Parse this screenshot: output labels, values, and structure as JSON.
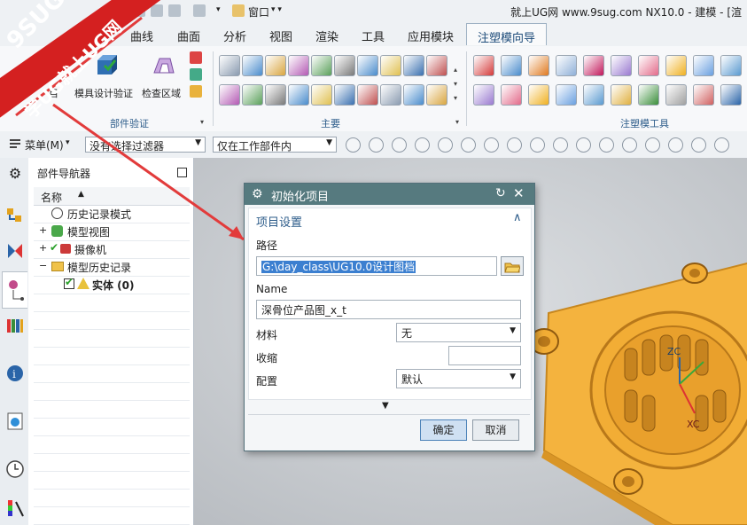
{
  "window": {
    "title": "就上UG网 www.9sug.com NX10.0 - 建模 - [渲",
    "menu_label": "窗口"
  },
  "tabs": [
    {
      "label": "曲线"
    },
    {
      "label": "曲面"
    },
    {
      "label": "分析"
    },
    {
      "label": "视图"
    },
    {
      "label": "渲染"
    },
    {
      "label": "工具"
    },
    {
      "label": "应用模块"
    },
    {
      "label": "注塑模向导"
    }
  ],
  "ribbon": {
    "group1": {
      "label": "部件验证",
      "btn_partial": "目",
      "btn_mold_verify": "模具设计验证",
      "btn_check_region": "检查区域"
    },
    "group2": {
      "label": "主要"
    },
    "group3": {
      "label": "注塑模工具"
    }
  },
  "filterbar": {
    "menu_label": "菜单(M)",
    "filter_value": "没有选择过滤器",
    "scope_value": "仅在工作部件内"
  },
  "navigator": {
    "title": "部件导航器",
    "column_name": "名称",
    "items": [
      {
        "label": "历史记录模式"
      },
      {
        "label": "模型视图"
      },
      {
        "label": "摄像机"
      },
      {
        "label": "模型历史记录"
      },
      {
        "label": "实体 (0)"
      }
    ]
  },
  "viewport": {
    "axis_labels": [
      "ZC",
      "XC"
    ]
  },
  "dialog": {
    "title": "初始化项目",
    "section": "项目设置",
    "path_label": "路径",
    "path_value": "G:\\day_class\\UG10.0设计图档",
    "name_label": "Name",
    "name_value": "深骨位产品图_x_t",
    "material_label": "材料",
    "material_value": "无",
    "shrink_label": "收缩",
    "shrink_value": "",
    "config_label": "配置",
    "config_value": "默认",
    "ok_label": "确定",
    "cancel_label": "取消"
  },
  "watermark": {
    "line1": "9SUG",
    "line2": "学UG就上UG网"
  },
  "colors": {
    "accent": "#567a7f",
    "part": "#f5b53a",
    "arrow": "#e23b3b"
  }
}
